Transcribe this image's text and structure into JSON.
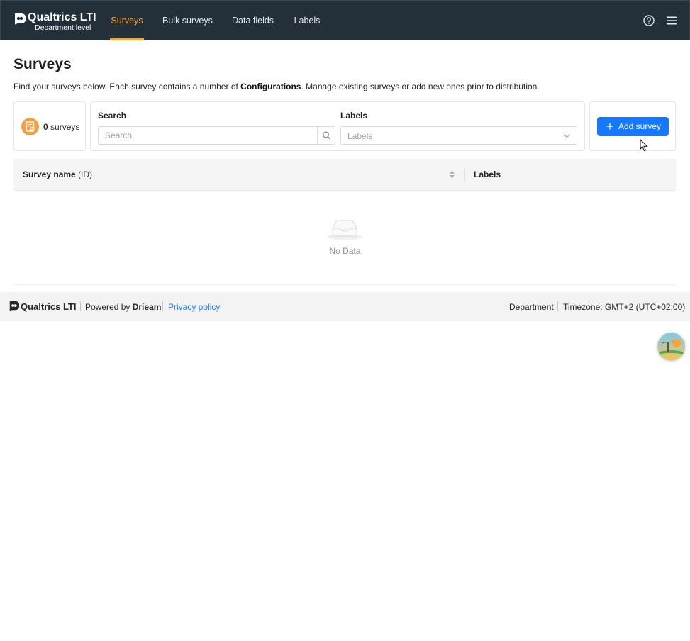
{
  "header": {
    "brand_title": "Qualtrics LTI",
    "brand_subtitle": "Department level",
    "tabs": [
      {
        "label": "Surveys",
        "active": true
      },
      {
        "label": "Bulk surveys",
        "active": false
      },
      {
        "label": "Data fields",
        "active": false
      },
      {
        "label": "Labels",
        "active": false
      }
    ],
    "icons": [
      "help-icon",
      "menu-icon"
    ],
    "accent_color": "#f0a83c",
    "background_color": "#243039"
  },
  "page": {
    "title": "Surveys",
    "description_before": "Find your surveys below. Each survey contains a number of ",
    "description_bold": "Configurations",
    "description_after": ". Manage existing surveys or add new ones prior to distribution."
  },
  "summary": {
    "count": "0",
    "count_label": "surveys",
    "icon": "survey-icon"
  },
  "filters": {
    "search_label": "Search",
    "search_placeholder": "Search",
    "search_value": "",
    "labels_label": "Labels",
    "labels_placeholder": "Labels"
  },
  "actions": {
    "add_survey_label": "Add survey",
    "primary_color": "#1677ff"
  },
  "table": {
    "columns": [
      {
        "label": "Survey name",
        "suffix": "(ID)",
        "sortable": true
      },
      {
        "label": "Labels",
        "sortable": false
      }
    ],
    "rows": [],
    "empty_text": "No Data"
  },
  "footer": {
    "brand": "Qualtrics LTI",
    "powered_by": "Powered by",
    "powered_company": "Drieam",
    "privacy_link": "Privacy policy",
    "scope": "Department",
    "timezone": "Timezone: GMT+2 (UTC+02:00)"
  }
}
